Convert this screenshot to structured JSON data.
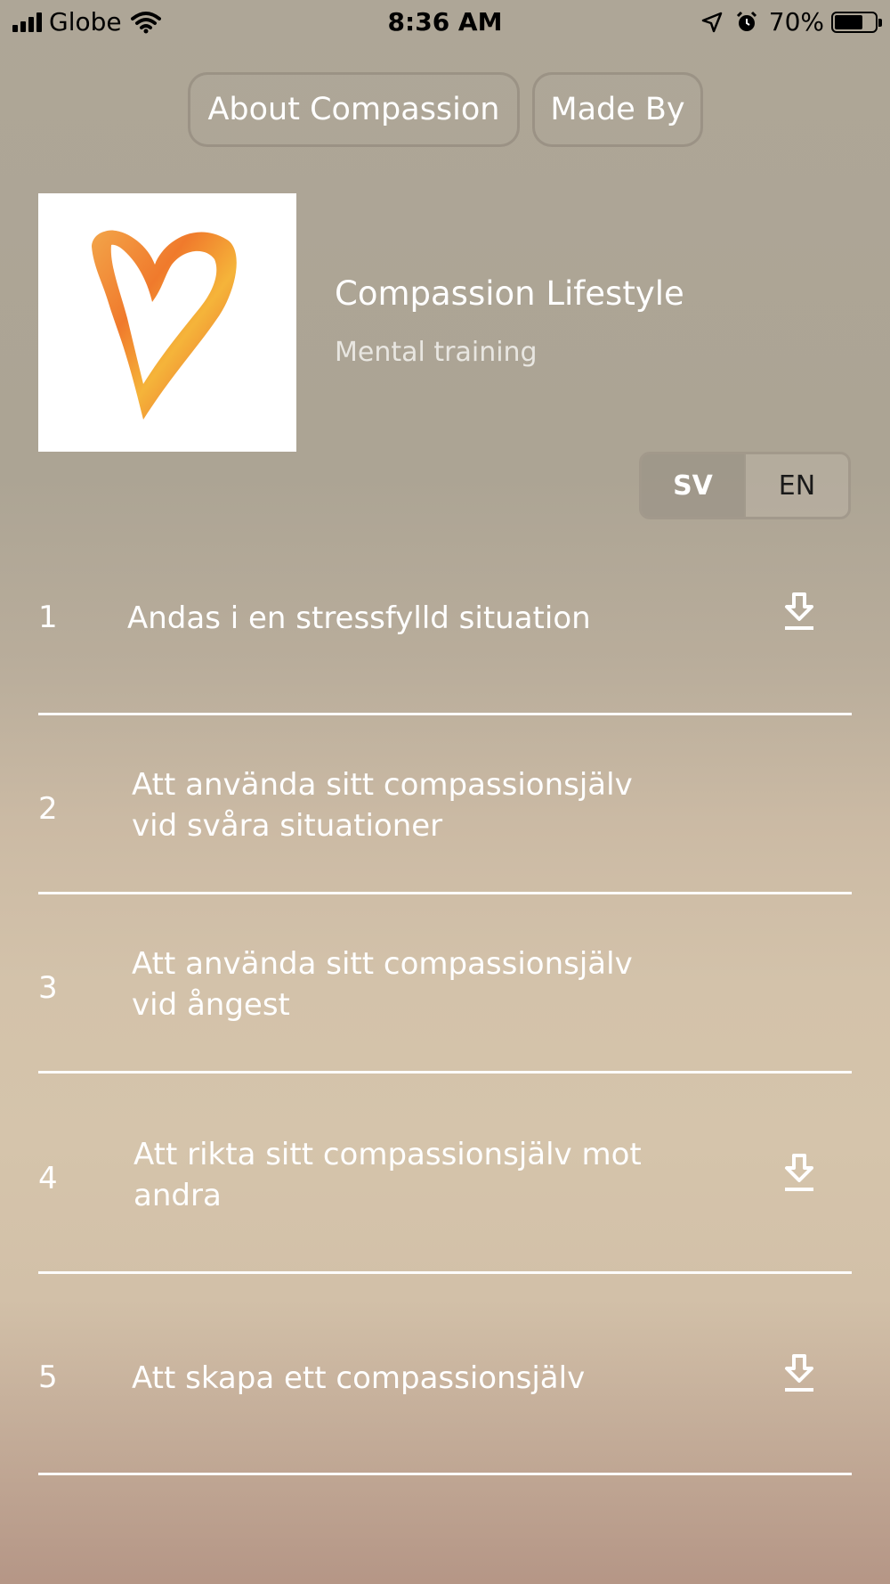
{
  "status_bar": {
    "carrier": "Globe",
    "time": "8:36 AM",
    "battery": "70%",
    "battery_level": 0.7
  },
  "header": {
    "about_button": "About Compassion",
    "made_by_button": "Made By"
  },
  "app": {
    "title": "Compassion Lifestyle",
    "subtitle": "Mental training",
    "logo_icon": "painted-heart-icon",
    "accent_colors": [
      "#f07a2c",
      "#f5b43a",
      "#e8562a"
    ]
  },
  "language_toggle": {
    "options": [
      "SV",
      "EN"
    ],
    "selected": "SV"
  },
  "tracks": [
    {
      "number": "1",
      "title": "Andas i en stressfylld situation",
      "download": true
    },
    {
      "number": "2",
      "title": "Att använda sitt compassionsjälv vid svåra situationer",
      "download": false
    },
    {
      "number": "3",
      "title": "Att använda sitt compassionsjälv vid ångest",
      "download": false
    },
    {
      "number": "4",
      "title": "Att rikta sitt compassionsjälv mot andra",
      "download": true
    },
    {
      "number": "5",
      "title": "Att skapa ett compassionsjälv",
      "download": true
    }
  ]
}
